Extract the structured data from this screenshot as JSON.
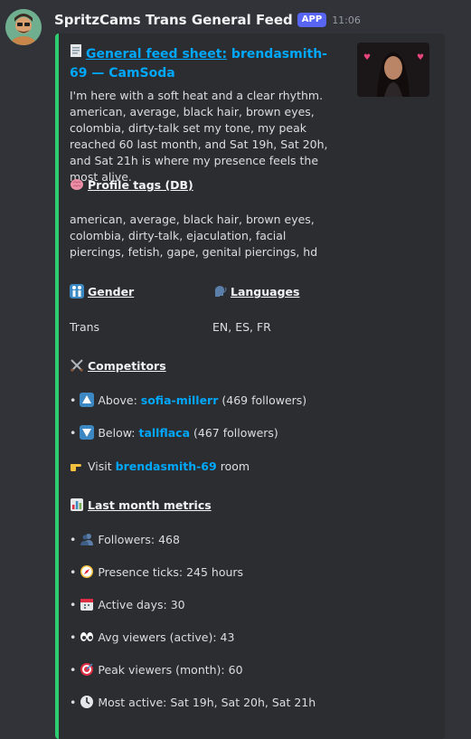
{
  "header": {
    "app_name": "SpritzCams Trans General Feed",
    "badge": "APP",
    "time": "11:06"
  },
  "embed": {
    "title_prefix": "General feed sheet",
    "title_sep": ":",
    "title_user": "brendasmith-69",
    "title_dash": "—",
    "title_site": "CamSoda",
    "description": "I'm here with a soft heat and a clear rhythm. american, average, black hair, brown eyes, colombia, dirty-talk set my tone, my peak reached 60 last month, and Sat 19h, Sat 20h, and Sat 21h is where my presence feels the most alive.",
    "profile_tags_label": "Profile tags (DB)",
    "profile_tags": "american, average, black hair, brown eyes, colombia, dirty-talk, ejaculation, facial piercings, fetish, gape, genital piercings, hd",
    "gender_label": "Gender",
    "gender_value": "Trans",
    "languages_label": "Languages",
    "languages_value": "EN, ES, FR",
    "competitors_label": "Competitors",
    "above_label": "Above:",
    "above_user": "sofia-millerr",
    "above_count": "(469 followers)",
    "below_label": "Below:",
    "below_user": "tallflaca",
    "below_count": "(467 followers)",
    "visit_label": "Visit",
    "visit_user": "brendasmith-69",
    "visit_suffix": "room",
    "metrics_label": "Last month metrics",
    "bullet": "•",
    "metrics": {
      "followers": "Followers: 468",
      "presence": "Presence ticks: 245 hours",
      "active_days": "Active days: 30",
      "avg_viewers": "Avg viewers (active): 43",
      "peak_viewers": "Peak viewers (month): 60",
      "most_active": "Most active: Sat 19h, Sat 20h, Sat 21h"
    }
  },
  "colors": {
    "accent_bar": "#2ecc71",
    "link": "#00a8fc",
    "badge": "#5865f2"
  },
  "icons": [
    "page-icon",
    "brain-icon",
    "couple-icon",
    "speaking-head-icon",
    "crossed-swords-icon",
    "up-arrow-icon",
    "down-arrow-icon",
    "pointing-hand-icon",
    "bar-chart-icon",
    "people-icon",
    "compass-icon",
    "calendar-icon",
    "eyes-icon",
    "target-icon",
    "clock-icon"
  ]
}
